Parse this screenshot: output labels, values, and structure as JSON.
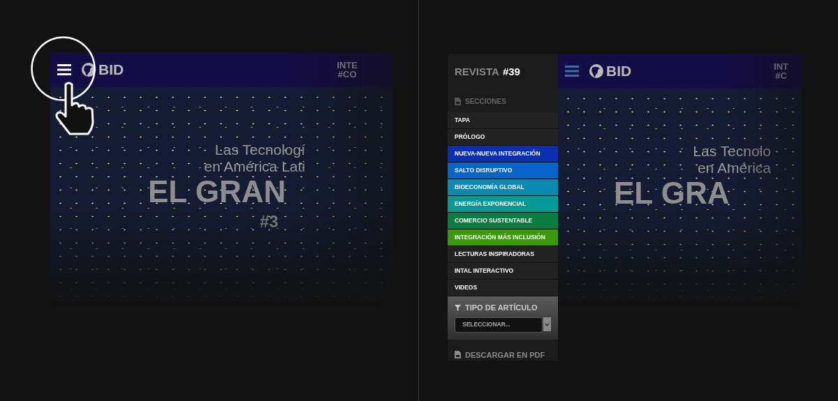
{
  "left_screen": {
    "brand": "BID",
    "header_texts": [
      "INTE",
      "#CO"
    ],
    "hero_lines": [
      "Las Tecnologí",
      "en América Lati"
    ],
    "headline": "EL GRAN",
    "issue": "#3"
  },
  "sidebar": {
    "title": "REVISTA",
    "issue": "#39",
    "sections_label": "SECCIONES",
    "items": [
      {
        "label": "TAPA",
        "color": "#222222"
      },
      {
        "label": "PRÓLOGO",
        "color": "#222222"
      },
      {
        "label": "NUEVA-NUEVA INTEGRACIÓN",
        "color": "#0a2fb5"
      },
      {
        "label": "SALTO DISRUPTIVO",
        "color": "#0565c9"
      },
      {
        "label": "BIOECONOMÍA GLOBAL",
        "color": "#0a8ab3"
      },
      {
        "label": "ENERGÍA EXPONENCIAL",
        "color": "#069a94"
      },
      {
        "label": "COMERCIO SUSTENTABLE",
        "color": "#0a7d3e"
      },
      {
        "label": "INTEGRACIÓN MÁS INCLUSIÓN",
        "color": "#3b9a0a"
      },
      {
        "label": "LECTURAS INSPIRADORAS",
        "color": "#222222"
      },
      {
        "label": "INTAL INTERACTIVO",
        "color": "#222222"
      },
      {
        "label": "VIDEOS",
        "color": "#222222"
      }
    ],
    "filter": {
      "label": "TIPO DE ARTÍCULO",
      "placeholder": "SELECCIONAR..."
    },
    "download": "DESCARGAR EN PDF"
  },
  "right_screen": {
    "brand": "BID",
    "header_texts": [
      "INT",
      "#C"
    ],
    "hero_lines": [
      "Las Tecnolo",
      "en América"
    ],
    "headline": "EL GRA"
  }
}
